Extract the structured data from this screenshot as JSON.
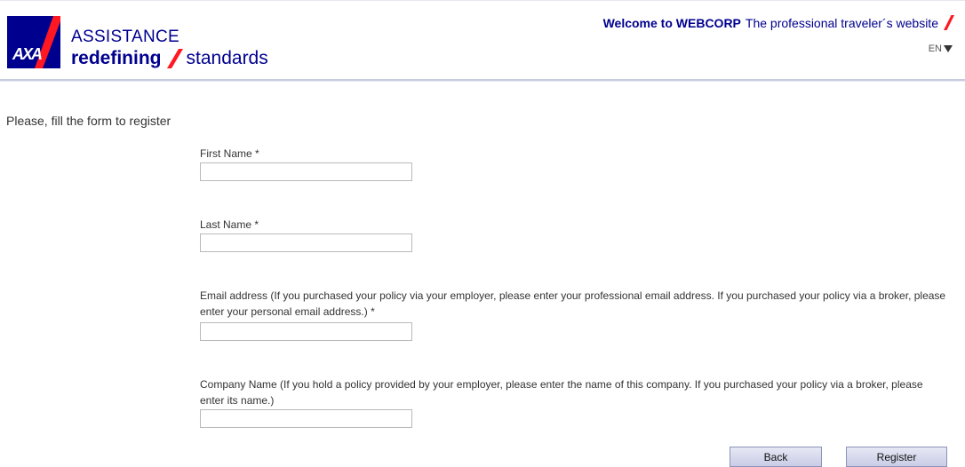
{
  "header": {
    "logo_text": "AXA",
    "brand_line1": "ASSISTANCE",
    "brand_line2_bold": "redefining",
    "brand_line2_rest": "standards",
    "welcome_bold": "Welcome to WEBCORP",
    "welcome_rest": "The professional traveler´s website",
    "language": "EN"
  },
  "colors": {
    "brand_blue": "#00008f",
    "brand_red": "#ff1721"
  },
  "form": {
    "intro": "Please, fill the form to register",
    "fields": [
      {
        "label": "First Name *",
        "value": ""
      },
      {
        "label": "Last Name *",
        "value": ""
      },
      {
        "label": "Email address (If you purchased your policy via your employer, please enter your professional email address. If you purchased your policy via a broker, please enter your personal email address.) *",
        "value": ""
      },
      {
        "label": "Company Name (If you hold a policy provided by your employer, please enter the name of this company. If you purchased your policy via a broker, please enter its name.)",
        "value": ""
      }
    ],
    "back_label": "Back",
    "register_label": "Register"
  }
}
